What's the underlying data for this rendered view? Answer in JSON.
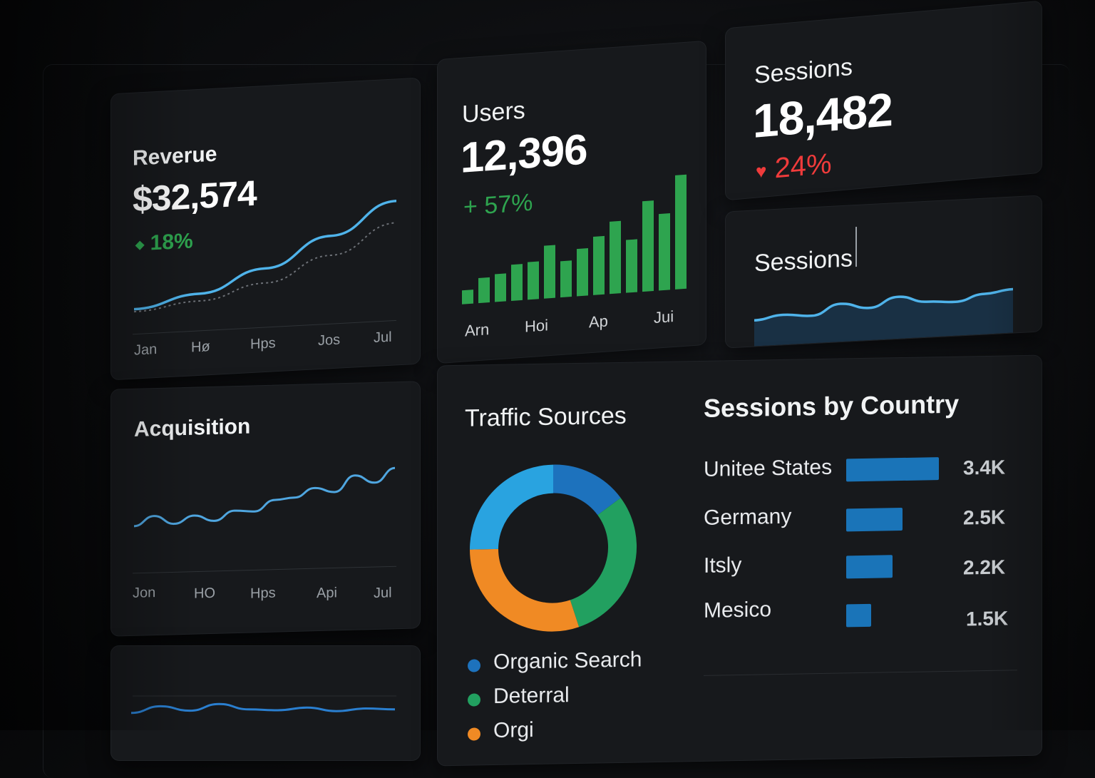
{
  "revenue": {
    "title": "Reverue",
    "value": "$32,574",
    "delta": "18%",
    "delta_icon": "up-diamond-icon",
    "ticks": [
      "Jan",
      "Hø",
      "Hps",
      "Jos",
      "Jul"
    ],
    "chart_data": {
      "type": "line",
      "x": [
        "Jan",
        "Hø",
        "Hps",
        "Jos",
        "Jul"
      ],
      "series": [
        {
          "values": [
            10,
            20,
            38,
            62,
            88
          ],
          "color": "#4fb3ea"
        },
        {
          "values": [
            8,
            14,
            26,
            46,
            70
          ],
          "color": "#6c7076",
          "style": "dotted"
        }
      ]
    }
  },
  "users": {
    "title": "Users",
    "value": "12,396",
    "delta": "57%",
    "delta_icon": "plus-icon",
    "ticks": [
      "Arn",
      "Hoi",
      "Ap",
      "Jui"
    ],
    "chart_data": {
      "type": "bar",
      "values": [
        10,
        18,
        20,
        26,
        27,
        38,
        26,
        34,
        42,
        52,
        38,
        65,
        55,
        82
      ],
      "color": "#2ea44f"
    }
  },
  "sessions_top": {
    "title": "Sessions",
    "value": "18,482",
    "delta": "24%",
    "delta_icon": "heart-icon",
    "delta_color": "#ef3b3b"
  },
  "sessions_spark": {
    "title": "Sessions",
    "chart_data": {
      "type": "area",
      "values": [
        40,
        45,
        42,
        55,
        48,
        60,
        52,
        50,
        58,
        62
      ]
    }
  },
  "acquisition": {
    "title": "Acquisition",
    "ticks": [
      "Jon",
      "HO",
      "Hps",
      "Api",
      "Jul"
    ],
    "chart_data": {
      "type": "line",
      "values": [
        20,
        35,
        22,
        34,
        25,
        40,
        38,
        55,
        58,
        72,
        65,
        90,
        78,
        100
      ]
    }
  },
  "traffic_sources": {
    "title": "Traffic Sources",
    "chart_data": {
      "type": "pie",
      "slices": [
        {
          "name": "Organic Search",
          "value": 15,
          "color": "#1d72bd"
        },
        {
          "name": "Deterral",
          "value": 30,
          "color": "#22a060"
        },
        {
          "name": "",
          "value": 30,
          "color": "#f08a24"
        },
        {
          "name": "",
          "value": 25,
          "color": "#29a3e0"
        }
      ]
    },
    "legend": [
      {
        "label": "Organic Search",
        "color": "#1d72bd"
      },
      {
        "label": "Deterral",
        "color": "#22a060"
      },
      {
        "label": "Orgi",
        "color": "#f08a24"
      }
    ]
  },
  "sessions_by_country": {
    "title": "Sessions by Country",
    "chart_data": {
      "type": "bar",
      "categories": [
        "Unitee States",
        "Germany",
        "Itsly",
        "Mesico"
      ],
      "values": [
        3.4,
        2.5,
        2.2,
        1.5
      ],
      "value_labels": [
        "3.4K",
        "2.5K",
        "2.2K",
        "1.5K"
      ],
      "unit": "K"
    }
  },
  "bottom_card": {
    "chart_data": {
      "type": "line",
      "values": [
        30,
        45,
        35,
        50,
        38,
        36,
        42,
        34,
        40,
        38
      ]
    }
  }
}
